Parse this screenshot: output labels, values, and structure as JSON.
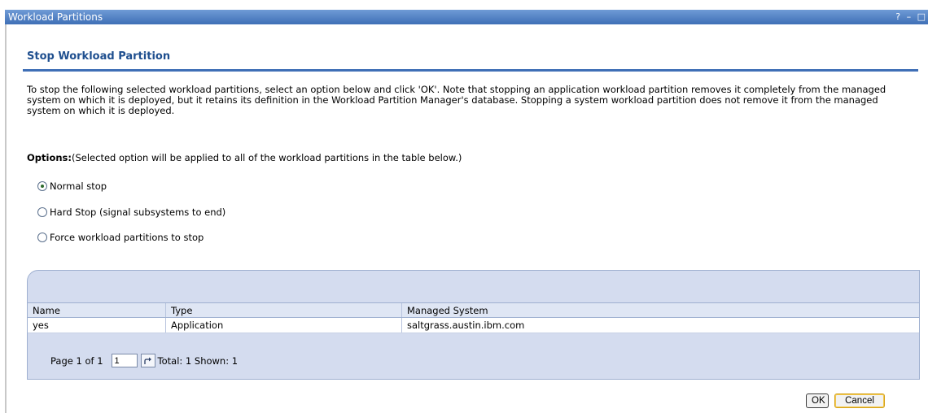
{
  "window": {
    "title": "Workload Partitions",
    "controls": [
      "?",
      "–",
      "□"
    ]
  },
  "page": {
    "heading": "Stop Workload Partition",
    "intro": "To stop the following selected workload partitions, select an option below and click 'OK'. Note that stopping an application workload partition removes it completely from the managed system on which it is deployed, but it retains its definition in the Workload Partition Manager's database. Stopping a system workload partition does not remove it from the managed system on which it is deployed.",
    "options_label": "Options:",
    "options_note": "(Selected option will be applied to all of the workload partitions in the table below.)",
    "options": [
      {
        "label": "Normal stop",
        "selected": true
      },
      {
        "label": "Hard Stop (signal subsystems to end)",
        "selected": false
      },
      {
        "label": "Force workload partitions to stop",
        "selected": false
      }
    ]
  },
  "table": {
    "columns": [
      "Name",
      "Type",
      "Managed System"
    ],
    "rows": [
      [
        "yes",
        "Application",
        "saltgrass.austin.ibm.com"
      ]
    ],
    "pager": {
      "page_text": "Page 1 of 1",
      "page_value": "1",
      "summary": "Total: 1 Shown: 1"
    }
  },
  "buttons": {
    "ok": "OK",
    "cancel": "Cancel"
  },
  "colors": {
    "accent": "#3f6fb6",
    "heading": "#1f4f8f",
    "table_panel": "#d4dcef"
  },
  "icons": [
    "radio-selected-icon",
    "radio-unselected-icon",
    "go-arrow-icon"
  ]
}
